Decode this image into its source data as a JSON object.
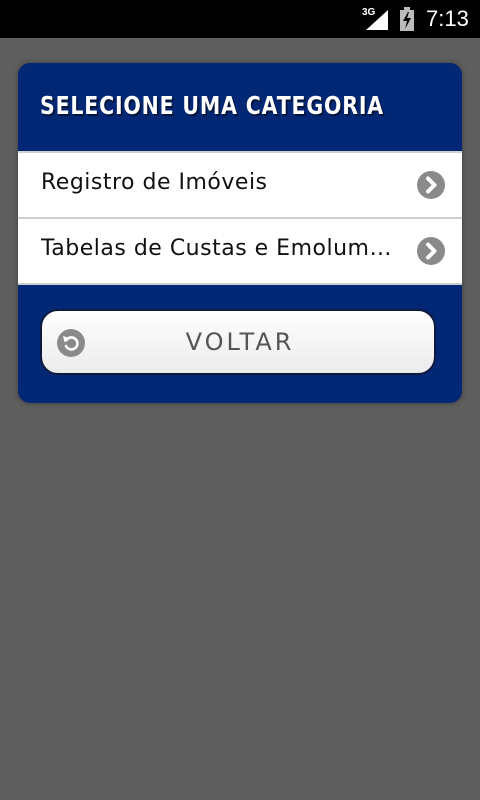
{
  "status_bar": {
    "network": "3G",
    "time": "7:13"
  },
  "dialog": {
    "title": "SELECIONE UMA CATEGORIA",
    "items": [
      {
        "label": "Registro de Imóveis",
        "icon": "chevron-right-icon"
      },
      {
        "label": "Tabelas de Custas e Emolumentos",
        "icon": "chevron-right-icon"
      }
    ],
    "back_button": {
      "label": "VOLTAR",
      "icon": "undo-icon"
    }
  },
  "colors": {
    "dialog_background": "#022875",
    "page_background": "#5e5e5e",
    "icon_gray": "#8a8a8a"
  }
}
